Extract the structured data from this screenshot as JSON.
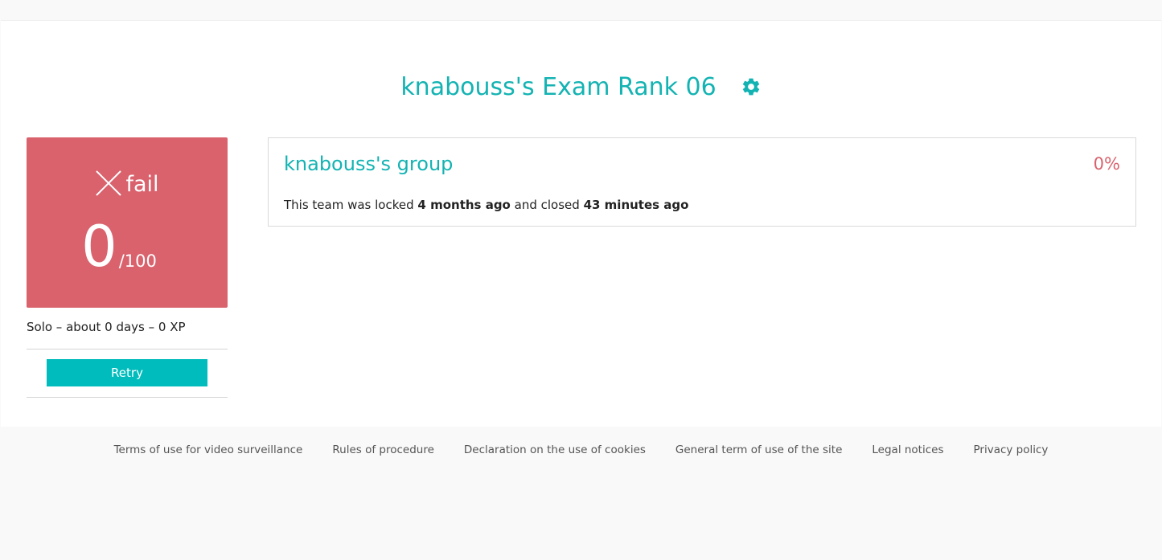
{
  "header": {
    "title": "knabouss's Exam Rank 06",
    "settings_icon": "gear-icon",
    "accent": "#14b3b3"
  },
  "score_card": {
    "status_icon": "close-icon",
    "status": "fail",
    "score": "0",
    "total": "/100",
    "color": "#d9626d"
  },
  "meta": "Solo – about 0 days – 0 XP",
  "retry_label": "Retry",
  "group": {
    "name": "knabouss's group",
    "percent": "0%",
    "status_prefix": "This team was locked",
    "locked_time": "4 months ago",
    "status_middle": "and closed",
    "closed_time": "43 minutes ago"
  },
  "footer": {
    "links": [
      "Terms of use for video surveillance",
      "Rules of procedure",
      "Declaration on the use of cookies",
      "General term of use of the site",
      "Legal notices",
      "Privacy policy"
    ]
  }
}
